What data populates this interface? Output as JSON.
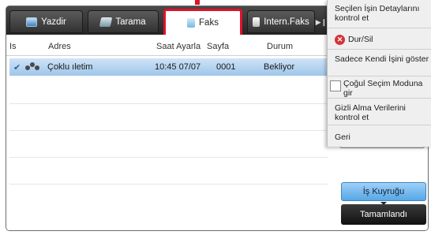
{
  "tabs": {
    "print": "Yazdir",
    "scan": "Tarama",
    "fax": "Faks",
    "ifax": "Intern.Faks",
    "more": "▶❙"
  },
  "columns": {
    "status": "Is",
    "address": "Adres",
    "time": "Saat Ayarla",
    "pages": "Sayfa",
    "state": "Durum"
  },
  "jobs": [
    {
      "check": "✔",
      "address": "Çoklu ıletim",
      "time": "10:45 07/07",
      "pages": "0001",
      "state": "Bekliyor"
    }
  ],
  "menu": {
    "details": "Seçilen İşin Detaylarını kontrol et",
    "stop": "Dur/Sil",
    "own_jobs": "Sadece Kendi İşini göster",
    "multi_select": "Çoğul Seçim Moduna gir",
    "hidden_data": "Gizli Alma Verilerini kontrol et",
    "back": "Geri"
  },
  "buttons": {
    "job_queue": "İş Kuyruğu",
    "completed": "Tamamlandı"
  },
  "colors": {
    "highlight": "#e1112b",
    "selected_row": "#b7d6f1",
    "queue_button": "#6db4ec"
  }
}
